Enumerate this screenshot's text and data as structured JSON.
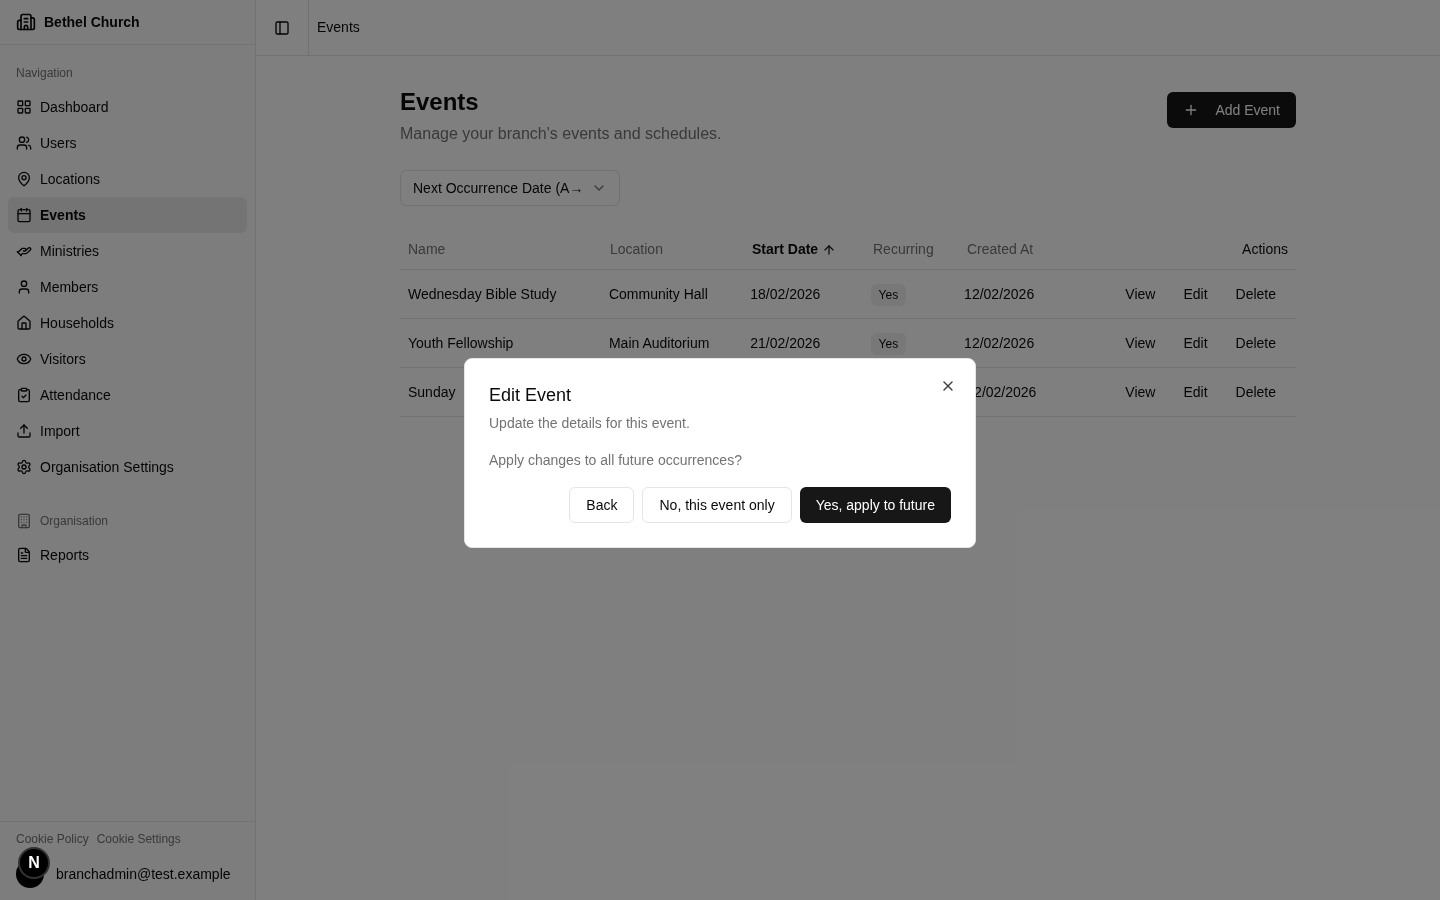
{
  "sidebar": {
    "org_name": "Bethel Church",
    "sections": [
      {
        "label": "Navigation",
        "items": [
          {
            "label": "Dashboard",
            "selected": false
          },
          {
            "label": "Users",
            "selected": false
          },
          {
            "label": "Locations",
            "selected": false
          },
          {
            "label": "Events",
            "selected": true
          },
          {
            "label": "Ministries",
            "selected": false
          },
          {
            "label": "Members",
            "selected": false
          },
          {
            "label": "Households",
            "selected": false
          },
          {
            "label": "Visitors",
            "selected": false
          },
          {
            "label": "Attendance",
            "selected": false
          },
          {
            "label": "Import",
            "selected": false
          },
          {
            "label": "Organisation Settings",
            "selected": false
          }
        ]
      },
      {
        "label": "Organisation",
        "items": [
          {
            "label": "Reports",
            "selected": false
          }
        ]
      }
    ],
    "footer_links": [
      "Cookie Policy",
      "Cookie Settings"
    ],
    "user_email": "branchadmin@test.example"
  },
  "dev_badge": {
    "label": "N"
  },
  "header": {
    "breadcrumb": "Events"
  },
  "page": {
    "title": "Events",
    "subtitle": "Manage your branch's events and schedules.",
    "add_button": "Add Event",
    "sort_select": "Next Occurrence Date (A→"
  },
  "table": {
    "columns": [
      {
        "label": "Name",
        "sorted": false
      },
      {
        "label": "Location",
        "sorted": false
      },
      {
        "label": "Start Date",
        "sorted": true
      },
      {
        "label": "Recurring",
        "sorted": false
      },
      {
        "label": "Created At",
        "sorted": false
      },
      {
        "label": "Actions",
        "sorted": false
      }
    ],
    "rows": [
      {
        "name": "Wednesday Bible Study",
        "location": "Community Hall",
        "start_date": "18/02/2026",
        "recurring": "Yes",
        "created_at": "12/02/2026",
        "actions": [
          "View",
          "Edit",
          "Delete"
        ]
      },
      {
        "name": "Youth Fellowship",
        "location": "Main Auditorium",
        "start_date": "21/02/2026",
        "recurring": "Yes",
        "created_at": "12/02/2026",
        "actions": [
          "View",
          "Edit",
          "Delete"
        ]
      },
      {
        "name": "Sunday",
        "created_at": "2/02/2026",
        "actions": [
          "View",
          "Edit",
          "Delete"
        ]
      }
    ]
  },
  "dialog": {
    "title": "Edit Event",
    "description": "Update the details for this event.",
    "question": "Apply changes to all future occurrences?",
    "buttons": [
      {
        "label": "Back",
        "kind": "outline"
      },
      {
        "label": "No, this event only",
        "kind": "outline"
      },
      {
        "label": "Yes, apply to future",
        "kind": "primary"
      }
    ]
  }
}
